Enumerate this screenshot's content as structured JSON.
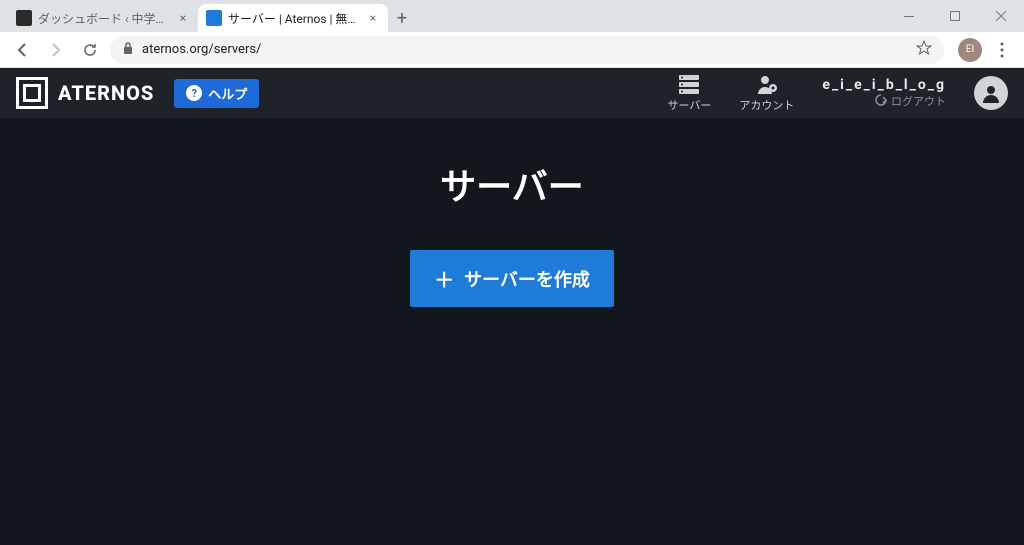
{
  "browser": {
    "tabs": [
      {
        "title": "ダッシュボード ‹ 中学生ののんびりブロ",
        "favicon_bg": "#2b2b2b"
      },
      {
        "title": "サーバー | Aternos | 無料のマインクラ",
        "favicon_bg": "#1e7bd8"
      }
    ],
    "url": "aternos.org/servers/",
    "profile_initial": "EI"
  },
  "header": {
    "logo_text": "ATERNOS",
    "help_label": "ヘルプ",
    "nav": {
      "servers_label": "サーバー",
      "account_label": "アカウント"
    },
    "username": "e_i_e_i_b_l_o_g",
    "logout_label": "ログアウト"
  },
  "main": {
    "title": "サーバー",
    "create_label": "サーバーを作成"
  }
}
